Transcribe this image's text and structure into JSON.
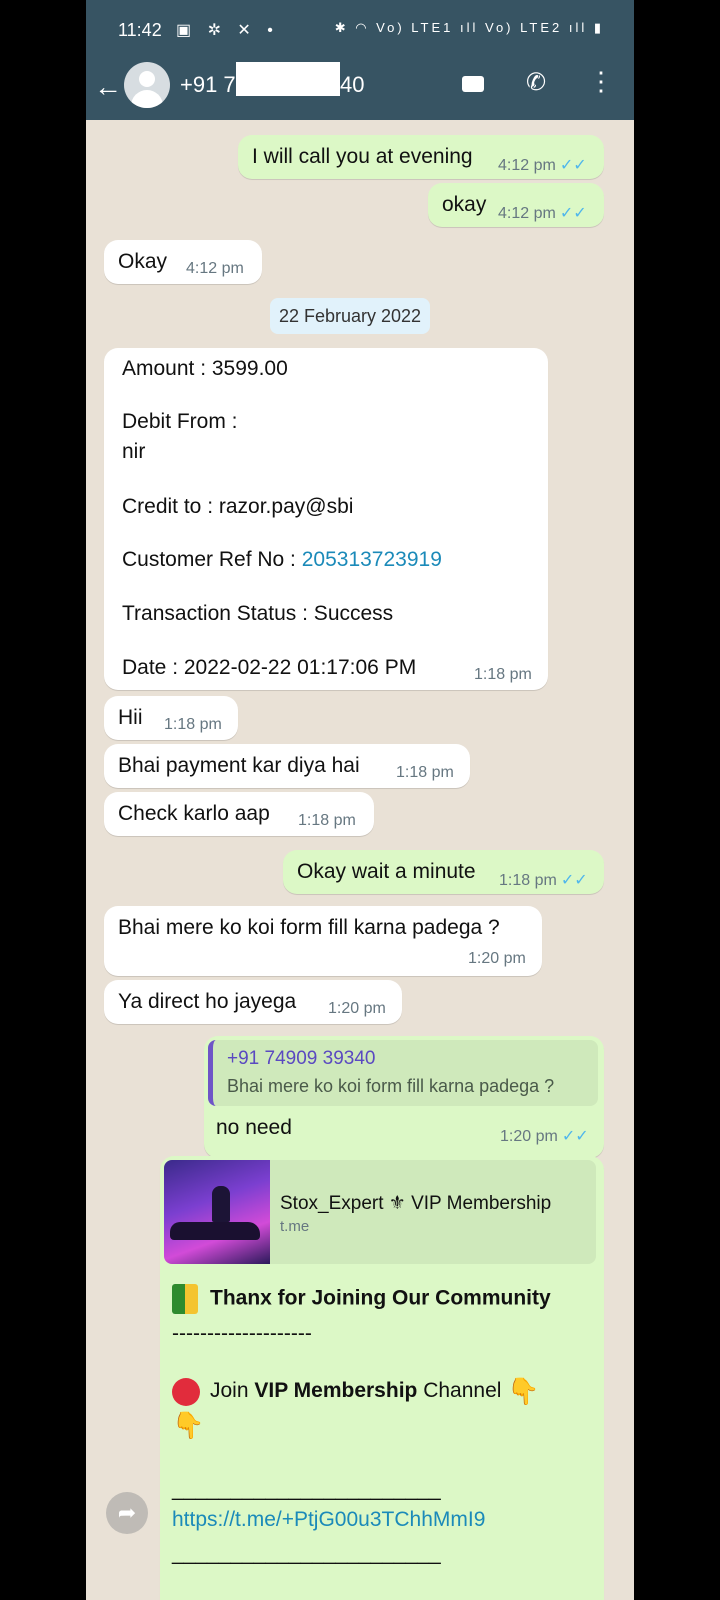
{
  "status_bar": {
    "time": "11:42",
    "left_icons": "▣ ✲ ✕ •",
    "right_icons": "✱ ◠ Vo) LTE1 ıll Vo) LTE2 ıll ▮"
  },
  "header": {
    "back_icon": "←",
    "contact_prefix": "+91 7",
    "contact_suffix": "40",
    "call_icon": "✆",
    "more_icon": "⋮"
  },
  "messages": [
    {
      "text": "I will call you at evening",
      "time": "4:12 pm",
      "ticks": "✓✓"
    },
    {
      "text": "okay",
      "time": "4:12 pm",
      "ticks": "✓✓"
    },
    {
      "text": "Okay",
      "time": "4:12 pm"
    },
    {
      "date": "22 February 2022"
    },
    {
      "amount_line": "Amount  : 3599.00",
      "debit_line": "Debit From  :",
      "debit_value": "nir",
      "credit_line": "Credit to : razor.pay@sbi",
      "ref_label": "Customer Ref No : ",
      "ref_value": "205313723919",
      "status_line": "Transaction Status  : Success",
      "date_line": "Date : 2022-02-22 01:17:06 PM",
      "time": "1:18 pm"
    },
    {
      "text": "Hii",
      "time": "1:18 pm"
    },
    {
      "text": "Bhai payment kar diya hai",
      "time": "1:18 pm"
    },
    {
      "text": "Check karlo aap",
      "time": "1:18 pm"
    },
    {
      "text": "Okay wait a minute",
      "time": "1:18 pm",
      "ticks": "✓✓"
    },
    {
      "text": "Bhai mere ko koi form fill karna padega ?",
      "time": "1:20 pm"
    },
    {
      "text": "Ya direct ho jayega",
      "time": "1:20 pm"
    },
    {
      "reply_name": "+91 74909 39340",
      "reply_text": "Bhai mere ko koi form fill karna padega ?",
      "text": "no need",
      "time": "1:20 pm",
      "ticks": "✓✓"
    },
    {
      "preview_title": "Stox_Expert ⚜ VIP Membership",
      "preview_sub": "t.me",
      "line1": "Thanx for Joining Our Community",
      "line2": "--------------------",
      "join_prefix": "Join ",
      "join_bold": "VIP Membership",
      "join_suffix": " Channel ",
      "hand": "👇",
      "underline1": "_______________________",
      "link": "https://t.me/+PtjG00u3TChhMmI9",
      "underline2": "_______________________"
    }
  ],
  "forward_icon": "➦"
}
